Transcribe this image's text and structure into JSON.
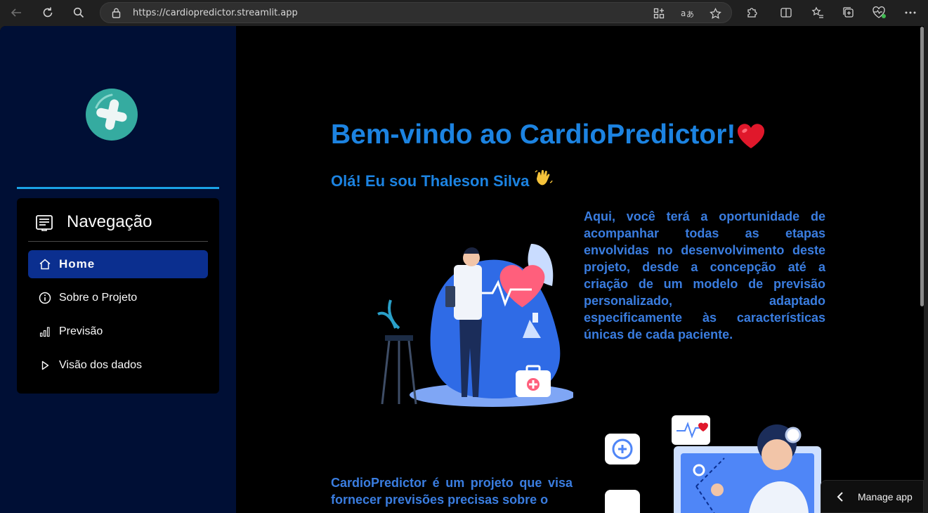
{
  "browser": {
    "url": "https://cardiopredictor.streamlit.app"
  },
  "sidebar": {
    "nav_title": "Navegação",
    "items": [
      {
        "label": "Home",
        "icon": "house-icon",
        "active": true
      },
      {
        "label": "Sobre o Projeto",
        "icon": "info-circle-icon",
        "active": false
      },
      {
        "label": "Previsão",
        "icon": "bar-chart-icon",
        "active": false
      },
      {
        "label": "Visão dos dados",
        "icon": "play-icon",
        "active": false
      }
    ]
  },
  "main": {
    "title": "Bem-vindo ao CardioPredictor!",
    "subtitle": "Olá! Eu sou Thaleson Silva",
    "paragraph1": "Aqui, você terá a oportunidade de acompanhar todas as etapas envolvidas no desenvolvimento deste projeto, desde a concepção até a criação de um modelo de previsão personalizado, adaptado especificamente às características únicas de cada paciente.",
    "paragraph2": "CardioPredictor é um projeto que visa fornecer previsões precisas sobre o"
  },
  "manage_app": {
    "label": "Manage app"
  },
  "colors": {
    "sidebar_bg": "#000f35",
    "accent": "#1c83e1",
    "active_item": "#0b2f8f",
    "divider": "#1aa3e6"
  }
}
